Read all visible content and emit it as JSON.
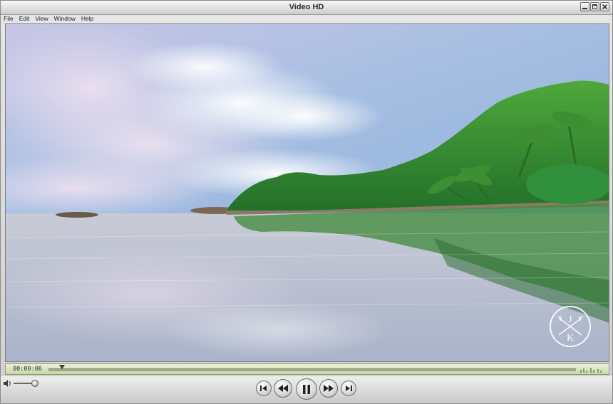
{
  "window": {
    "title": "Video HD"
  },
  "menu": [
    "File",
    "Edit",
    "View",
    "Window",
    "Help"
  ],
  "player": {
    "timecode": "00:00:06",
    "progress": 0.01,
    "volume": 0.9,
    "playback_state": "playing"
  },
  "controls": {
    "icons": [
      "skip-back-icon",
      "rewind-icon",
      "pause-icon",
      "fast-forward-icon",
      "skip-forward-icon"
    ]
  },
  "watermark": {
    "letters": "J K"
  },
  "colors": {
    "timeline_fill": "#d2deb3",
    "sky": "#9fbcdf",
    "foliage": "#2f8a2e"
  }
}
